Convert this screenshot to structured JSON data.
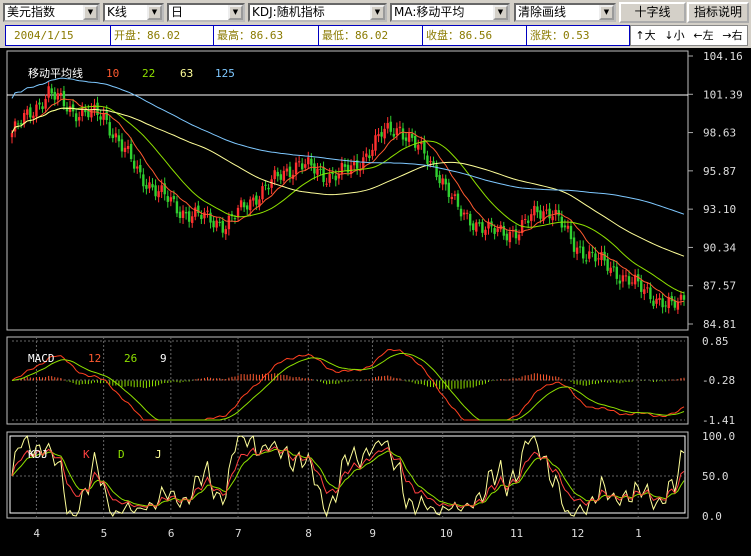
{
  "toolbar": {
    "symbol": "美元指数",
    "chart_type": "K线",
    "period": "日",
    "indicator": "KDJ:随机指标",
    "overlay": "MA:移动平均",
    "drawing": "清除画线",
    "crosshair_button": "十字线",
    "help_button": "指标说明"
  },
  "info": {
    "date": "2004/1/15",
    "open": "开盘：86.02",
    "high": "最高：86.63",
    "low": "最低：86.02",
    "close": "收盘：86.56",
    "change": "涨跌：0.53"
  },
  "nav": {
    "up": "↑大",
    "down": "↓小",
    "left": "←左",
    "right": "→右"
  },
  "colors": {
    "up": "#ff3030",
    "down": "#30d030",
    "ma10": "#ff5a30",
    "ma22": "#8ee000",
    "ma63": "#ffff99",
    "ma125": "#7ec8ff"
  },
  "chart_data": {
    "type": "candlestick",
    "main": {
      "title": "移动平均线",
      "ma_periods": [
        "10",
        "22",
        "63",
        "125"
      ],
      "y_ticks": [
        "104.16",
        "101.39",
        "98.63",
        "95.87",
        "93.10",
        "90.34",
        "87.57",
        "84.81"
      ],
      "ylim": [
        84.81,
        104.16
      ],
      "close_anchors": [
        [
          0,
          98.6
        ],
        [
          12,
          101.5
        ],
        [
          20,
          100.2
        ],
        [
          30,
          99.8
        ],
        [
          42,
          95.5
        ],
        [
          55,
          93
        ],
        [
          70,
          92
        ],
        [
          82,
          94.5
        ],
        [
          94,
          96.5
        ],
        [
          102,
          95.5
        ],
        [
          112,
          96
        ],
        [
          121,
          98.5
        ],
        [
          127,
          99
        ],
        [
          135,
          97
        ],
        [
          139,
          96
        ],
        [
          146,
          93
        ],
        [
          156,
          91.5
        ],
        [
          166,
          91.5
        ],
        [
          172,
          93
        ],
        [
          177,
          93
        ],
        [
          184,
          90.5
        ],
        [
          195,
          89
        ],
        [
          205,
          87.5
        ],
        [
          216,
          86
        ],
        [
          220,
          86.56
        ]
      ]
    },
    "macd": {
      "title": "MACD",
      "params": [
        "12",
        "26",
        "9"
      ],
      "y_ticks": [
        "0.85",
        "-0.28",
        "-1.41"
      ],
      "ylim": [
        -1.41,
        0.85
      ]
    },
    "kdj": {
      "title": "KDJ",
      "lines": [
        "K",
        "D",
        "J"
      ],
      "y_ticks": [
        "100.0",
        "50.0",
        "0.0"
      ],
      "ylim": [
        0,
        100
      ]
    },
    "x_ticks": [
      "4",
      "5",
      "6",
      "7",
      "8",
      "9",
      "10",
      "11",
      "12",
      "1"
    ]
  }
}
